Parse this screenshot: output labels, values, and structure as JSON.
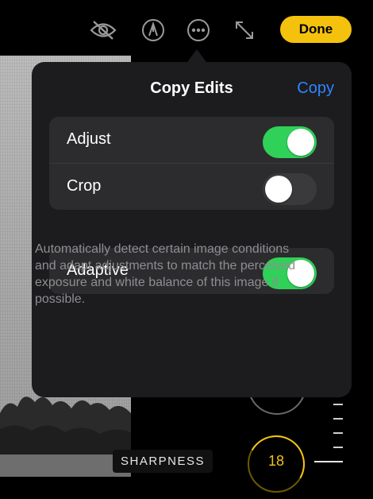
{
  "toolbar": {
    "icons": [
      "hide-icon",
      "markup-icon",
      "more-icon",
      "resize-icon"
    ],
    "done_label": "Done"
  },
  "popover": {
    "title": "Copy Edits",
    "copy_label": "Copy",
    "options": [
      {
        "label": "Adjust",
        "on": true
      },
      {
        "label": "Crop",
        "on": false
      }
    ],
    "adaptive": {
      "label": "Adaptive",
      "on": true
    },
    "description": "Automatically detect certain image conditions and adapt adjustments to match the perceived exposure and white balance of this image if possible."
  },
  "editor": {
    "tool_label": "SHARPNESS",
    "tool_value": "18"
  },
  "colors": {
    "accent_blue": "#2e86ff",
    "toggle_on": "#30d158",
    "done_yellow": "#f4c20d",
    "dial_yellow": "#f0c419"
  }
}
